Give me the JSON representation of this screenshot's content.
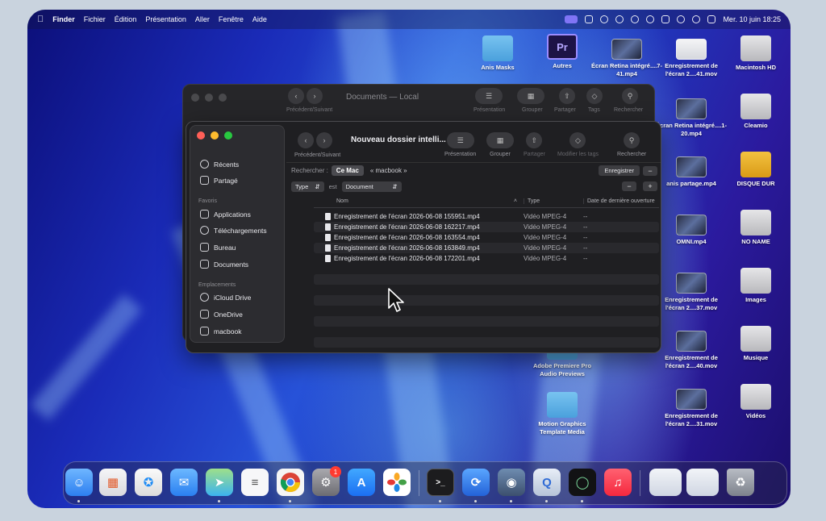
{
  "menubar": {
    "app_name": "Finder",
    "items": [
      "Fichier",
      "Édition",
      "Présentation",
      "Aller",
      "Fenêtre",
      "Aide"
    ],
    "clock": "Mer. 10 juin  18:25"
  },
  "desktop_icons": [
    {
      "label": "Anis Masks",
      "icon": "folder-icon"
    },
    {
      "label": "Autres",
      "icon": "premiere-project-icon"
    },
    {
      "label": "Écran Retina intégré....7-41.mp4",
      "icon": "video-thumbnail-icon"
    },
    {
      "label": "Enregistrement de l'écran 2....41.mov",
      "icon": "video-thumbnail-icon"
    },
    {
      "label": "Macintosh HD",
      "icon": "hard-drive-icon"
    },
    {
      "label": "Écran Retina intégré....1-20.mp4",
      "icon": "video-thumbnail-icon"
    },
    {
      "label": "Cleamio",
      "icon": "drive-icon"
    },
    {
      "label": "anis partage.mp4",
      "icon": "video-thumbnail-icon"
    },
    {
      "label": "DISQUE DUR",
      "icon": "external-drive-icon"
    },
    {
      "label": "OMNI.mp4",
      "icon": "video-thumbnail-icon"
    },
    {
      "label": "NO NAME",
      "icon": "usb-drive-icon"
    },
    {
      "label": "Enregistrement de l'écran 2....37.mov",
      "icon": "video-thumbnail-icon"
    },
    {
      "label": "Images",
      "icon": "images-folder-icon"
    },
    {
      "label": "Adobe Premiere Pro Audio Previews",
      "icon": "folder-icon"
    },
    {
      "label": "Enregistrement de l'écran 2....40.mov",
      "icon": "video-thumbnail-icon"
    },
    {
      "label": "Musique",
      "icon": "music-folder-icon"
    },
    {
      "label": "Motion Graphics Template Media",
      "icon": "folder-icon"
    },
    {
      "label": "Enregistrement de l'écran 2....31.mov",
      "icon": "video-thumbnail-icon"
    },
    {
      "label": "Vidéos",
      "icon": "videos-folder-icon"
    }
  ],
  "back_window": {
    "title": "Documents — Local",
    "nav_label": "Précédent/Suivant",
    "tools": [
      "Présentation",
      "Grouper",
      "Partager",
      "Tags",
      "Rechercher"
    ]
  },
  "front_window": {
    "title": "Nouveau dossier intelli...",
    "nav_label": "Précédent/Suivant",
    "tools": [
      "Présentation",
      "Grouper",
      "Partager",
      "Modifier les tags",
      "Rechercher"
    ],
    "sidebar": {
      "top_items": [
        "Récents",
        "Partagé"
      ],
      "favorites_header": "Favoris",
      "favorites": [
        "Applications",
        "Téléchargements",
        "Bureau",
        "Documents"
      ],
      "locations_header": "Emplacements",
      "locations": [
        "iCloud Drive",
        "OneDrive",
        "macbook"
      ]
    },
    "search": {
      "label": "Rechercher :",
      "scope_selected": "Ce Mac",
      "scope_other": "« macbook »",
      "save": "Enregistrer",
      "minus": "−"
    },
    "criteria": {
      "attribute": "Type",
      "operator": "est",
      "value": "Document",
      "minus": "−",
      "plus": "+"
    },
    "columns": {
      "name": "Nom",
      "type": "Type",
      "date": "Date de dernière ouverture"
    },
    "files": [
      {
        "name": "Enregistrement de l'écran 2026-06-08 155951.mp4",
        "type": "Vidéo MPEG-4",
        "date": "--"
      },
      {
        "name": "Enregistrement de l'écran 2026-06-08 162217.mp4",
        "type": "Vidéo MPEG-4",
        "date": "--"
      },
      {
        "name": "Enregistrement de l'écran 2026-06-08 163554.mp4",
        "type": "Vidéo MPEG-4",
        "date": "--"
      },
      {
        "name": "Enregistrement de l'écran 2026-06-08 163849.mp4",
        "type": "Vidéo MPEG-4",
        "date": "--"
      },
      {
        "name": "Enregistrement de l'écran 2026-06-08 172201.mp4",
        "type": "Vidéo MPEG-4",
        "date": "--"
      }
    ]
  },
  "dock": {
    "apps": [
      "Finder",
      "Launchpad",
      "Safari",
      "Mail",
      "Plans",
      "Rappels",
      "Chrome",
      "Réglages Système",
      "App Store",
      "Photos",
      "Terminal",
      "Cleamio",
      "Utilitaire",
      "QuickTime Player",
      "Motion",
      "Musique"
    ],
    "settings_badge": "1",
    "colors": {
      "finder": "#3a8ef0",
      "safari": "#1f8cf5",
      "mail": "#3c8df0",
      "music": "#fa3c4c",
      "appstore": "#1b7cf2"
    }
  }
}
